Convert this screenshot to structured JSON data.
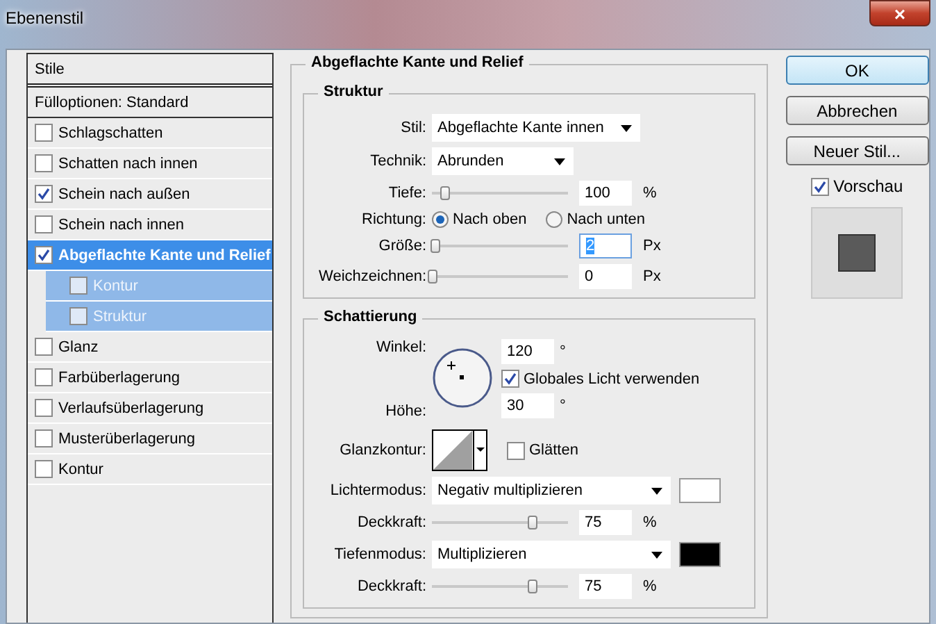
{
  "window": {
    "title": "Ebenenstil",
    "close": "×"
  },
  "styles": {
    "header": "Stile",
    "items": [
      {
        "label": "Fülloptionen: Standard",
        "kind": "option",
        "selected": false
      },
      {
        "label": "Schlagschatten",
        "kind": "checkbox",
        "checked": false,
        "selected": false
      },
      {
        "label": "Schatten nach innen",
        "kind": "checkbox",
        "checked": false,
        "selected": false
      },
      {
        "label": "Schein nach außen",
        "kind": "checkbox",
        "checked": true,
        "selected": false
      },
      {
        "label": "Schein nach innen",
        "kind": "checkbox",
        "checked": false,
        "selected": false
      },
      {
        "label": "Abgeflachte Kante und Relief",
        "kind": "checkbox",
        "checked": true,
        "selected": true,
        "children": [
          {
            "label": "Kontur",
            "checked": false
          },
          {
            "label": "Struktur",
            "checked": false
          }
        ]
      },
      {
        "label": "Glanz",
        "kind": "checkbox",
        "checked": false,
        "selected": false
      },
      {
        "label": "Farbüberlagerung",
        "kind": "checkbox",
        "checked": false,
        "selected": false
      },
      {
        "label": "Verlaufsüberlagerung",
        "kind": "checkbox",
        "checked": false,
        "selected": false
      },
      {
        "label": "Musterüberlagerung",
        "kind": "checkbox",
        "checked": false,
        "selected": false
      },
      {
        "label": "Kontur",
        "kind": "checkbox",
        "checked": false,
        "selected": false
      }
    ]
  },
  "panel": {
    "title": "Abgeflachte Kante und Relief",
    "structure": {
      "title": "Struktur",
      "style": {
        "label": "Stil:",
        "value": "Abgeflachte Kante innen"
      },
      "technique": {
        "label": "Technik:",
        "value": "Abrunden"
      },
      "depth": {
        "label": "Tiefe:",
        "level": 0.09,
        "value": "100",
        "unit": "%"
      },
      "direction": {
        "label": "Richtung:",
        "options": [
          {
            "label": "Nach oben",
            "selected": true
          },
          {
            "label": "Nach unten",
            "selected": false
          }
        ]
      },
      "size": {
        "label": "Größe:",
        "level": 0.02,
        "value": "2",
        "unit": "Px"
      },
      "soften": {
        "label": "Weichzeichnen:",
        "level": 0,
        "value": "0",
        "unit": "Px"
      }
    },
    "shading": {
      "title": "Schattierung",
      "angle": {
        "label": "Winkel:",
        "value": "120",
        "unit": "°"
      },
      "global_light": {
        "label": "Globales Licht verwenden",
        "checked": true
      },
      "altitude": {
        "label": "Höhe:",
        "value": "30",
        "unit": "°"
      },
      "gloss_contour": {
        "label": "Glanzkontur:"
      },
      "anti_aliased": {
        "label": "Glätten",
        "checked": false
      },
      "highlight_mode": {
        "label": "Lichtermodus:",
        "value": "Negativ multiplizieren",
        "color": "#ffffff"
      },
      "highlight_opacity": {
        "label": "Deckkraft:",
        "level": 0.75,
        "value": "75",
        "unit": "%"
      },
      "shadow_mode": {
        "label": "Tiefenmodus:",
        "value": "Multiplizieren",
        "color": "#000000"
      },
      "shadow_opacity": {
        "label": "Deckkraft:",
        "level": 0.75,
        "value": "75",
        "unit": "%"
      }
    }
  },
  "buttons": [
    {
      "label": "OK",
      "default": true
    },
    {
      "label": "Abbrechen",
      "default": false
    },
    {
      "label": "Neuer Stil...",
      "default": false
    }
  ],
  "preview": {
    "label": "Vorschau",
    "checked": true
  }
}
